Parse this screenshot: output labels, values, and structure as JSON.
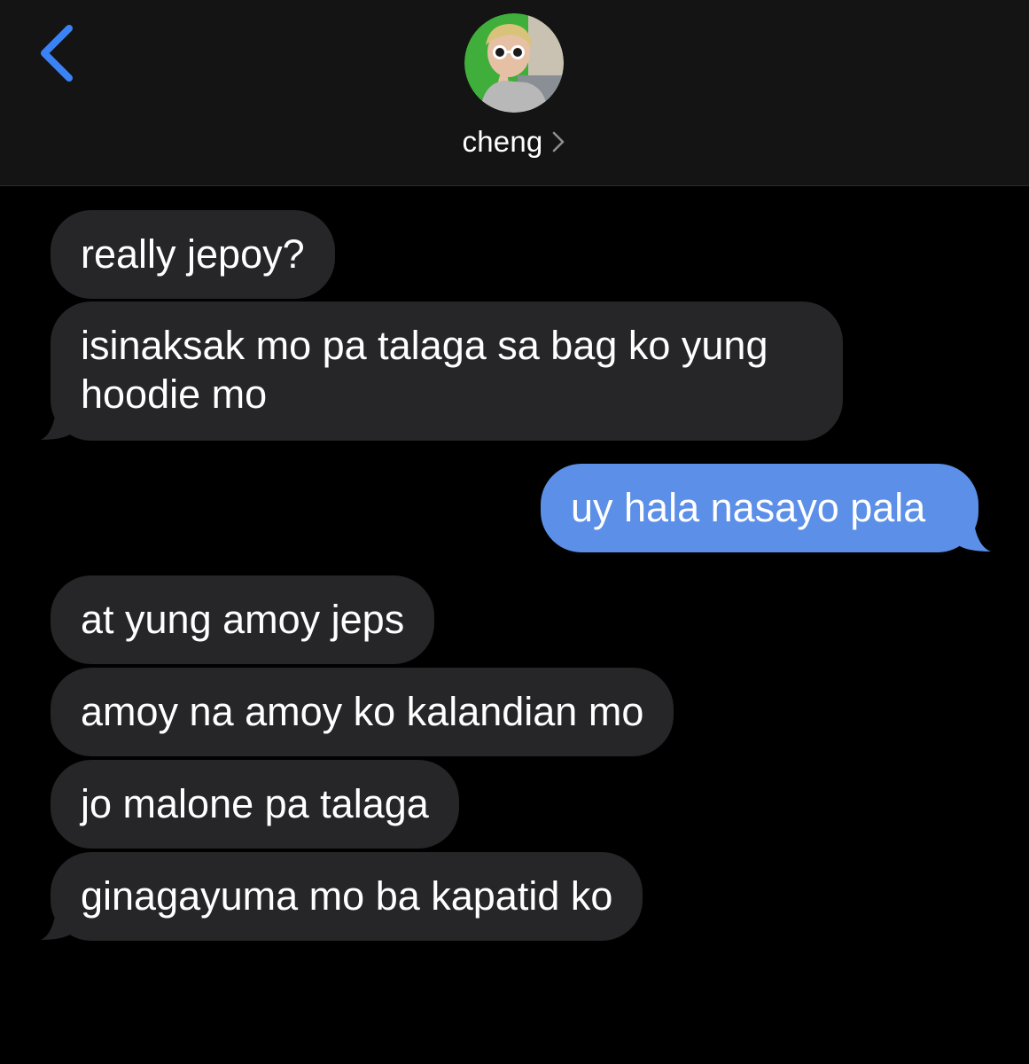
{
  "header": {
    "contact_name": "cheng",
    "back_icon": "chevron-left-icon",
    "name_chevron_icon": "chevron-right-icon",
    "accent_color": "#3a82f6"
  },
  "messages": [
    {
      "direction": "incoming",
      "text": "really jepoy?"
    },
    {
      "direction": "incoming",
      "lines": [
        "isinaksak mo pa talaga sa bag ko yung",
        "hoodie mo"
      ]
    },
    {
      "direction": "outgoing",
      "text": "uy hala nasayo pala"
    },
    {
      "direction": "incoming",
      "text": "at yung amoy jeps"
    },
    {
      "direction": "incoming",
      "text": "amoy na amoy ko kalandian mo"
    },
    {
      "direction": "incoming",
      "text": "jo malone pa talaga"
    },
    {
      "direction": "incoming",
      "text": "ginagayuma mo ba kapatid ko"
    }
  ],
  "colors": {
    "incoming_bubble": "#262628",
    "outgoing_bubble": "#5b8fe8",
    "header_bg": "#141414",
    "background": "#000000"
  }
}
